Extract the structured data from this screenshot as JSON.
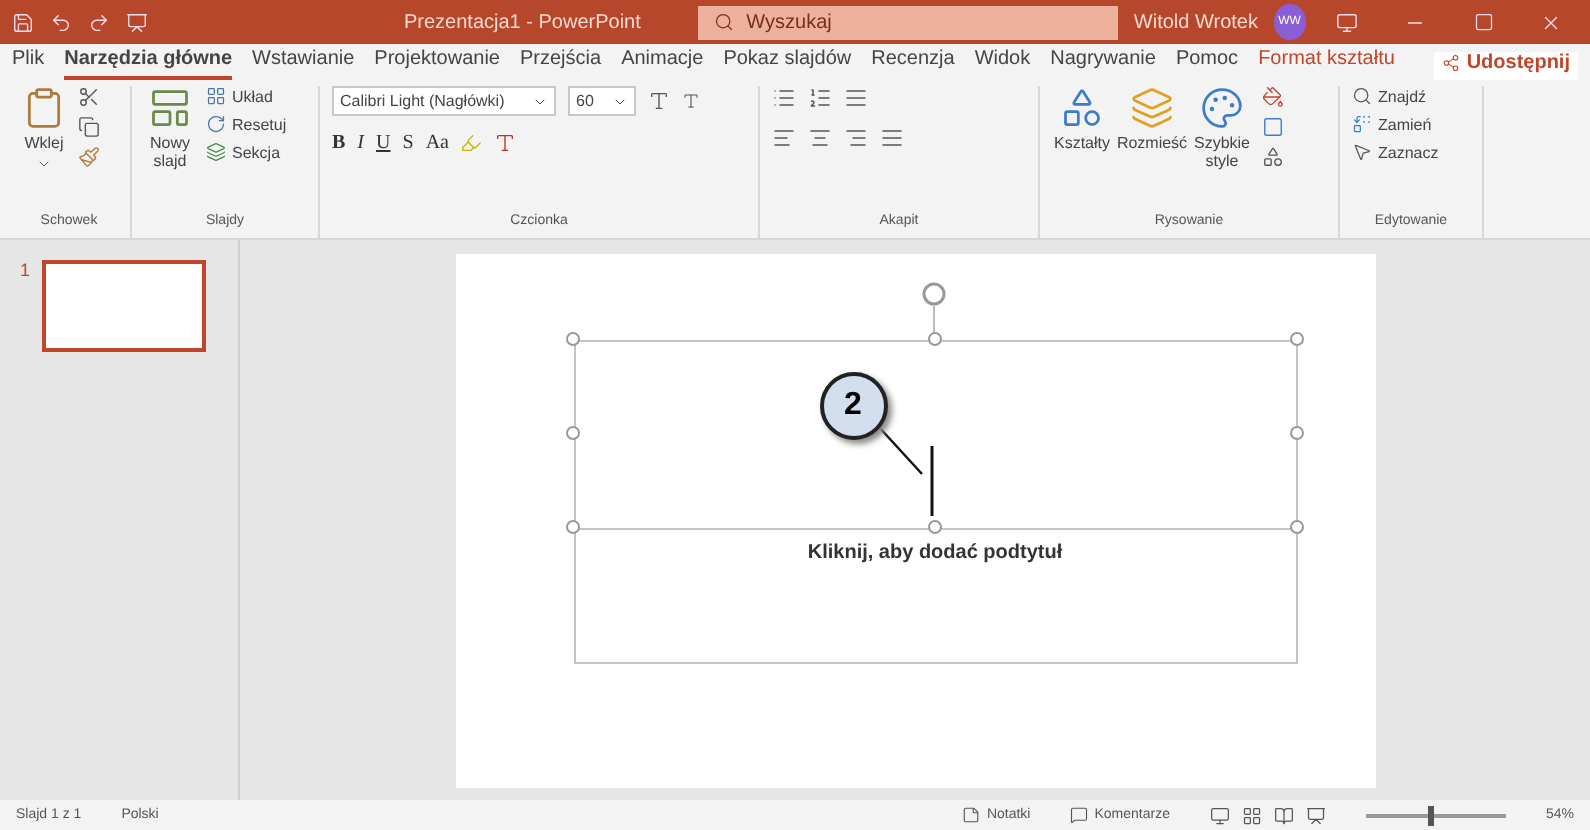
{
  "title_bar": {
    "title": "Prezentacja1 - PowerPoint",
    "search_placeholder": "Wyszukaj",
    "user": "Witold Wrotek",
    "avatar": "WW"
  },
  "tabs": [
    {
      "label": "Plik",
      "selected": false,
      "kind": "normal"
    },
    {
      "label": "Narzędzia główne",
      "selected": true,
      "kind": "normal"
    },
    {
      "label": "Wstawianie",
      "selected": false,
      "kind": "normal"
    },
    {
      "label": "Projektowanie",
      "selected": false,
      "kind": "normal"
    },
    {
      "label": "Przejścia",
      "selected": false,
      "kind": "normal"
    },
    {
      "label": "Animacje",
      "selected": false,
      "kind": "normal"
    },
    {
      "label": "Pokaz slajdów",
      "selected": false,
      "kind": "normal"
    },
    {
      "label": "Recenzja",
      "selected": false,
      "kind": "normal"
    },
    {
      "label": "Widok",
      "selected": false,
      "kind": "normal"
    },
    {
      "label": "Nagrywanie",
      "selected": false,
      "kind": "normal"
    },
    {
      "label": "Pomoc",
      "selected": false,
      "kind": "normal"
    },
    {
      "label": "Format kształtu",
      "selected": false,
      "kind": "contextual"
    }
  ],
  "share": "Udostępnij",
  "ribbon": {
    "clipboard": {
      "name": "Schowek",
      "paste": "Wklej"
    },
    "slides": {
      "name": "Slajdy",
      "new_slide": "Nowy slajd",
      "layout": "Układ",
      "reset": "Resetuj",
      "section": "Sekcja"
    },
    "font": {
      "name": "Czcionka",
      "font_family": "Calibri Light (Nagłówki)",
      "font_size": "60",
      "styles": [
        "B",
        "I",
        "U",
        "S"
      ],
      "case": "Aa"
    },
    "paragraph": {
      "name": "Akapit"
    },
    "drawing": {
      "name": "Rysowanie",
      "shapes": "Kształty",
      "arrange": "Rozmieść",
      "quick_styles": "Szybkie style"
    },
    "editing": {
      "name": "Edytowanie",
      "find": "Znajdź",
      "replace": "Zamień",
      "select": "Zaznacz"
    }
  },
  "thumbnails": [
    {
      "number": "1",
      "selected": true
    }
  ],
  "slide": {
    "subtitle_placeholder": "Kliknij, aby dodać podtytuł",
    "callout": "2"
  },
  "status_bar": {
    "slide_info": "Slajd 1 z 1",
    "language": "Polski",
    "notes": "Notatki",
    "comments": "Komentarze",
    "zoom": {
      "level": 0.45
    },
    "zoom_reading": "54%"
  }
}
